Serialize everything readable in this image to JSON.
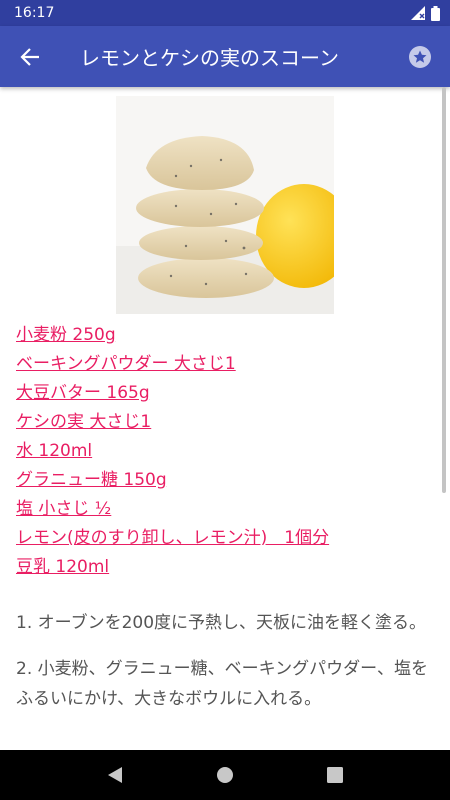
{
  "status_bar": {
    "time": "16:17"
  },
  "app_bar": {
    "title": "レモンとケシの実のスコーン"
  },
  "ingredients": [
    "小麦粉 250g",
    "ベーキングパウダー 大さじ1",
    "大豆バター 165g",
    "ケシの実 大さじ1",
    "水 120ml",
    "グラニュー糖 150g",
    "塩 小さじ ½",
    "レモン(皮のすり卸し、レモン汁)　1個分",
    "豆乳 120ml"
  ],
  "steps": [
    "1. オーブンを200度に予熱し、天板に油を軽く塗る。",
    "2. 小麦粉、グラニュー糖、ベーキングパウダー、塩をふるいにかけ、大きなボウルに入れる。"
  ],
  "colors": {
    "status_bar": "#303f9f",
    "app_bar": "#3f51b5",
    "link": "#e91e63",
    "text": "#555555",
    "nav_bar": "#000000"
  }
}
